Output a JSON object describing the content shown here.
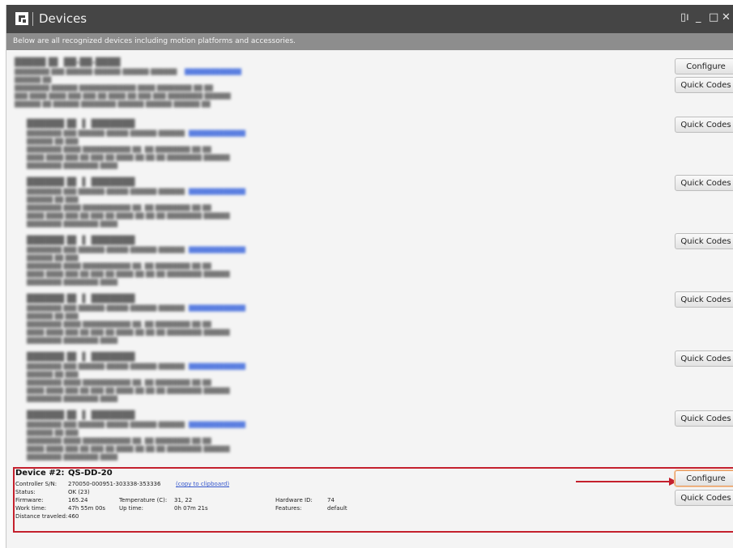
{
  "window": {
    "title": "Devices"
  },
  "info_text": "Below are all recognized devices including motion platforms and accessories.",
  "buttons": {
    "configure": "Configure",
    "quick_codes": "Quick Codes"
  },
  "device2": {
    "heading": "Device #2:",
    "name": "QS-DD-20",
    "controller_sn_label": "Controller S/N:",
    "controller_sn": "270050-000951-303338-353336",
    "copy_link": "(copy to clipboard)",
    "status_label": "Status:",
    "status": "OK (23)",
    "firmware_label": "Firmware:",
    "firmware": "165.24",
    "temperature_label": "Temperature (C):",
    "temperature": "31, 22",
    "hardware_id_label": "Hardware ID:",
    "hardware_id": "74",
    "work_time_label": "Work time:",
    "work_time": "47h 55m 00s",
    "up_time_label": "Up time:",
    "up_time": "0h 07m 21s",
    "features_label": "Features:",
    "features": "default",
    "distance_label": "Distance traveled:",
    "distance": "460"
  }
}
